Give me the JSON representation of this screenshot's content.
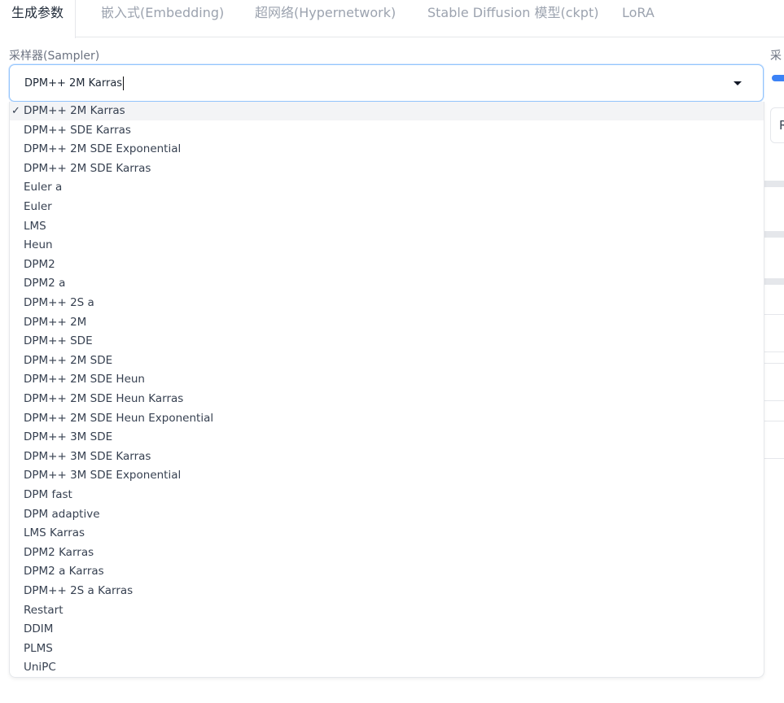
{
  "tabs": [
    {
      "label": "生成参数",
      "active": true
    },
    {
      "label": "嵌入式(Embedding)",
      "active": false
    },
    {
      "label": "超网络(Hypernetwork)",
      "active": false
    },
    {
      "label": "Stable Diffusion 模型(ckpt)",
      "active": false
    },
    {
      "label": "LoRA",
      "active": false
    }
  ],
  "sampler": {
    "label": "采样器(Sampler)",
    "selected_value": "DPM++ 2M Karras",
    "check_mark": "✓",
    "options": [
      "DPM++ 2M Karras",
      "DPM++ SDE Karras",
      "DPM++ 2M SDE Exponential",
      "DPM++ 2M SDE Karras",
      "Euler a",
      "Euler",
      "LMS",
      "Heun",
      "DPM2",
      "DPM2 a",
      "DPM++ 2S a",
      "DPM++ 2M",
      "DPM++ SDE",
      "DPM++ 2M SDE",
      "DPM++ 2M SDE Heun",
      "DPM++ 2M SDE Heun Karras",
      "DPM++ 2M SDE Heun Exponential",
      "DPM++ 3M SDE",
      "DPM++ 3M SDE Karras",
      "DPM++ 3M SDE Exponential",
      "DPM fast",
      "DPM adaptive",
      "LMS Karras",
      "DPM2 Karras",
      "DPM2 a Karras",
      "DPM++ 2S a Karras",
      "Restart",
      "DDIM",
      "PLMS",
      "UniPC"
    ]
  },
  "right_panel": {
    "label_fragment": "采",
    "field_fragment": "R"
  },
  "colors": {
    "accent": "#3b82f6",
    "focus_border": "#93c5fd",
    "selected_row": "#f3f4f6"
  }
}
